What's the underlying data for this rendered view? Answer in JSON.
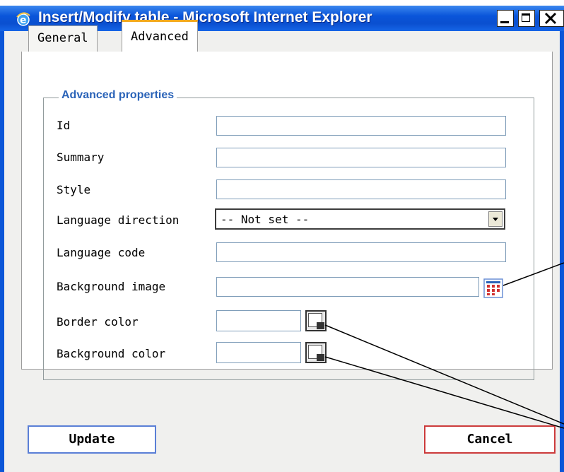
{
  "window": {
    "title": "Insert/Modify table - Microsoft Internet Explorer",
    "icon": "ie-icon",
    "controls": [
      "minimize-icon",
      "maximize-icon",
      "close-icon"
    ]
  },
  "tabs": [
    {
      "label": "General",
      "active": false
    },
    {
      "label": "Advanced",
      "active": true
    }
  ],
  "fieldset": {
    "legend": "Advanced properties",
    "fields": {
      "id": {
        "label": "Id",
        "value": ""
      },
      "summary": {
        "label": "Summary",
        "value": ""
      },
      "style": {
        "label": "Style",
        "value": ""
      },
      "direction": {
        "label": "Language direction",
        "value": "-- Not set --"
      },
      "lang_code": {
        "label": "Language code",
        "value": ""
      },
      "bg_image": {
        "label": "Background image",
        "value": ""
      },
      "border_color": {
        "label": "Border color",
        "value": ""
      },
      "bg_color": {
        "label": "Background color",
        "value": ""
      }
    }
  },
  "buttons": {
    "update": "Update",
    "cancel": "Cancel"
  },
  "colors": {
    "titlebar": "#0a55da",
    "legend": "#2a63b8",
    "active_tab_accent": "#f2a91d",
    "update_border": "#5a7fd6",
    "cancel_border": "#cc3b3b"
  }
}
